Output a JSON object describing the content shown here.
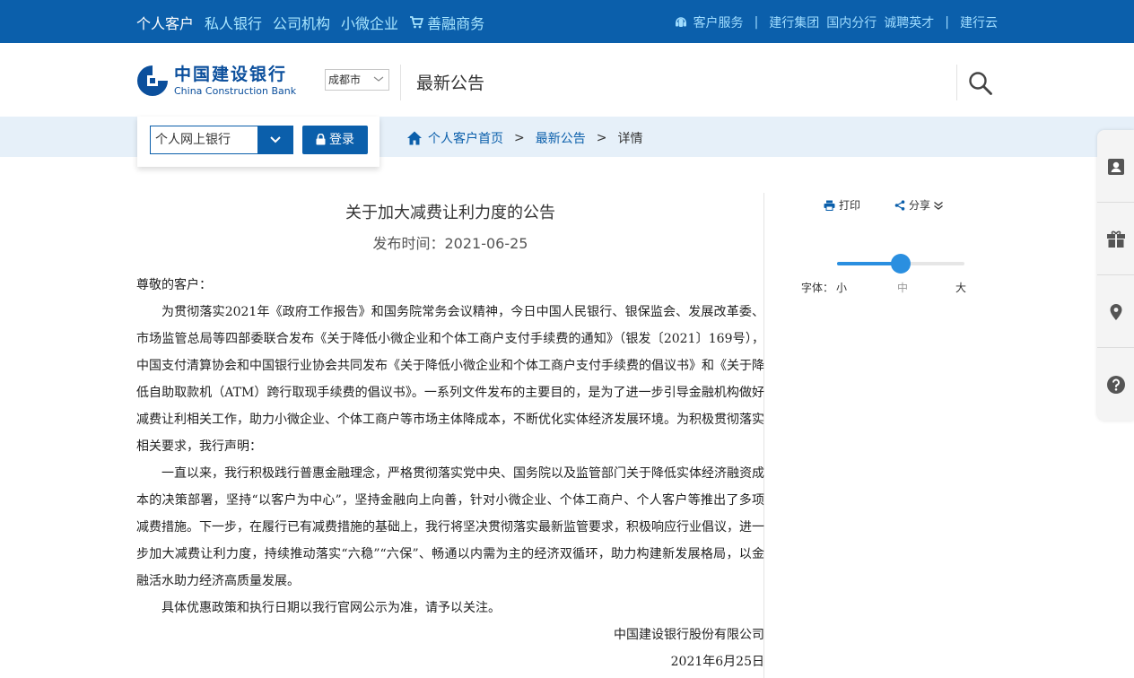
{
  "topnav": {
    "personal": "个人客户",
    "private": "私人银行",
    "corporate": "公司机构",
    "small_biz": "小微企业",
    "charity": "善融商务"
  },
  "topright": {
    "service": "客户服务",
    "group": "建行集团",
    "branches": "国内分行",
    "careers": "诚聘英才",
    "cloud": "建行云",
    "sep": "|"
  },
  "header": {
    "logo_cn": "中国建设银行",
    "logo_en": "China Construction Bank",
    "city": "成都市",
    "section": "最新公告"
  },
  "login": {
    "select_value": "个人网上银行",
    "button": "登录"
  },
  "breadcrumb": {
    "home": "个人客户首页",
    "news": "最新公告",
    "current": "详情",
    "sep": ">"
  },
  "article": {
    "title": "关于加大减费让利力度的公告",
    "date": "发布时间：2021-06-25",
    "greeting": "尊敬的客户：",
    "p1": "为贯彻落实2021年《政府工作报告》和国务院常务会议精神，今日中国人民银行、银保监会、发展改革委、市场监管总局等四部委联合发布《关于降低小微企业和个体工商户支付手续费的通知》（银发〔2021〕169号），中国支付清算协会和中国银行业协会共同发布《关于降低小微企业和个体工商户支付手续费的倡议书》和《关于降低自助取款机（ATM）跨行取现手续费的倡议书》。一系列文件发布的主要目的，是为了进一步引导金融机构做好减费让利相关工作，助力小微企业、个体工商户等市场主体降成本，不断优化实体经济发展环境。为积极贯彻落实相关要求，我行声明：",
    "p2": "一直以来，我行积极践行普惠金融理念，严格贯彻落实党中央、国务院以及监管部门关于降低实体经济融资成本的决策部署，坚持“以客户为中心”，坚持金融向上向善，针对小微企业、个体工商户、个人客户等推出了多项减费措施。下一步，在履行已有减费措施的基础上，我行将坚决贯彻落实最新监管要求，积极响应行业倡议，进一步加大减费让利力度，持续推动落实“六稳”“六保”、畅通以内需为主的经济双循环，助力构建新发展格局，以金融活水助力经济高质量发展。",
    "p3": "具体优惠政策和执行日期以我行官网公示为准，请予以关注。",
    "signature": "中国建设银行股份有限公司",
    "sign_date": "2021年6月25日"
  },
  "tools": {
    "print": "打印",
    "share": "分享",
    "font_label": "字体：",
    "small": "小",
    "medium": "中",
    "large": "大",
    "font_level": 0.5
  },
  "icons": [
    "cart-icon",
    "customer-service-icon",
    "search-icon",
    "chevron-down-icon",
    "lock-icon",
    "home-icon",
    "printer-icon",
    "share-icon",
    "contact-card-icon",
    "gift-icon",
    "location-pin-icon",
    "help-icon"
  ],
  "colors": {
    "brand_blue": "#0b5fab",
    "light_cyan": "#a9e6ff",
    "strip": "#e6f0f9",
    "slider": "#2a8fe0"
  }
}
